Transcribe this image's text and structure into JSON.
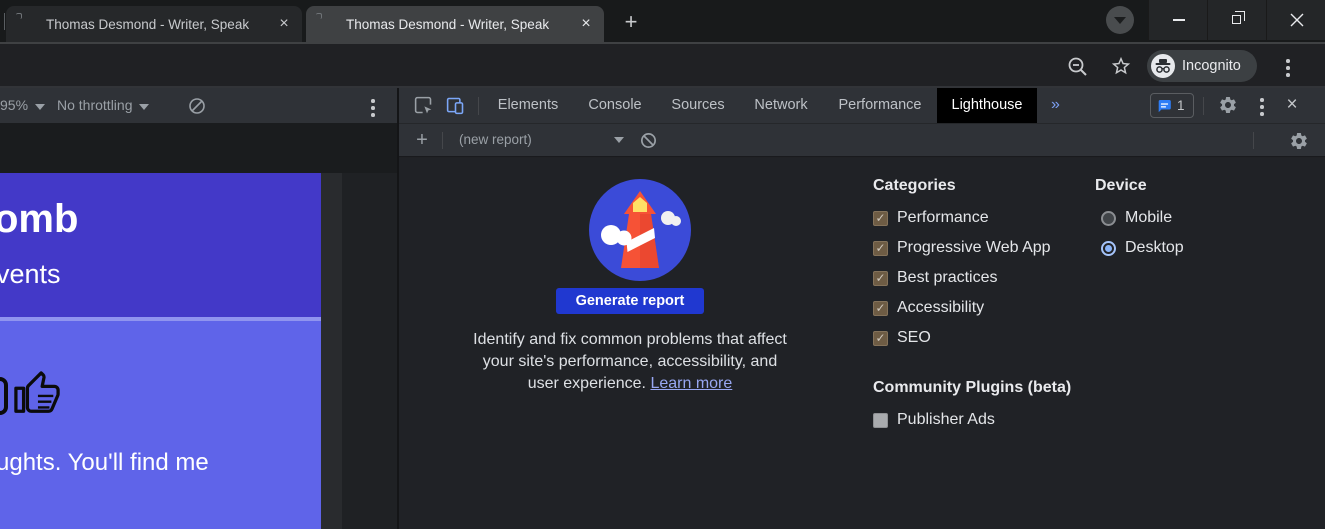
{
  "browser": {
    "tabs": [
      {
        "title": "Thomas Desmond - Writer, Speak",
        "active": false
      },
      {
        "title": "Thomas Desmond - Writer, Speak",
        "active": true
      }
    ],
    "new_tab_label": "+",
    "close_glyph": "×",
    "incognito_label": "Incognito"
  },
  "device_toolbar": {
    "zoom_value": "95%",
    "throttling_value": "No throttling"
  },
  "devtools": {
    "tabs": [
      {
        "label": "Elements"
      },
      {
        "label": "Console"
      },
      {
        "label": "Sources"
      },
      {
        "label": "Network"
      },
      {
        "label": "Performance"
      },
      {
        "label": "Lighthouse"
      }
    ],
    "selected_tab": "Lighthouse",
    "more_tabs_glyph": "»",
    "issues_count": "1",
    "close_glyph": "×",
    "lighthouse_bar": {
      "new_report_glyph": "+",
      "report_select_value": "(new report)"
    },
    "start_view": {
      "generate_button_label": "Generate report",
      "description": "Identify and fix common problems that affect your site's performance, accessibility, and user experience.",
      "learn_more_label": "Learn more",
      "categories": {
        "title": "Categories",
        "items": [
          {
            "label": "Performance",
            "checked": true
          },
          {
            "label": "Progressive Web App",
            "checked": true
          },
          {
            "label": "Best practices",
            "checked": true
          },
          {
            "label": "Accessibility",
            "checked": true
          },
          {
            "label": "SEO",
            "checked": true
          }
        ]
      },
      "device": {
        "title": "Device",
        "options": [
          {
            "label": "Mobile",
            "selected": false
          },
          {
            "label": "Desktop",
            "selected": true
          }
        ]
      },
      "plugins": {
        "title": "Community Plugins (beta)",
        "items": [
          {
            "label": "Publisher Ads",
            "checked": false
          }
        ]
      }
    }
  },
  "page": {
    "heading_fragment": "omb",
    "nav_fragment": "vents",
    "body_fragment": "ughts. You'll find me"
  },
  "colors": {
    "generate_button_blue": "#2038d0",
    "learn_more_link": "#98a7f2",
    "logo_circle_blue": "#3b4bd8",
    "lighthouse_red": "#f65236",
    "lighthouse_window_yellow": "#ffe066",
    "page_hero_purple": "#4339c8",
    "page_lower_purple": "#5f64e9",
    "checkbox_checked_brown": "#6e5c44",
    "radio_selected_blue": "#89b3f7",
    "issues_badge_blue": "#2e7df6",
    "selected_devtools_tab_bg": "#000000"
  }
}
